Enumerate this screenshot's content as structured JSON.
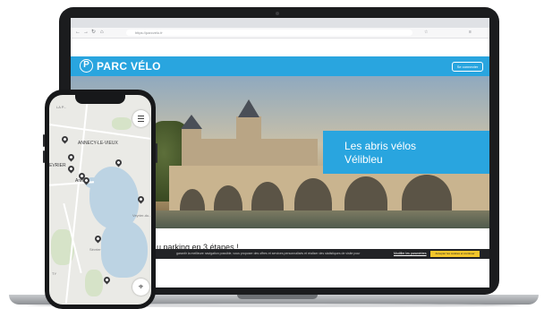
{
  "browser": {
    "url": "https://parcvelo.fr",
    "nav_back": "←",
    "nav_forward": "→",
    "nav_reload": "↻",
    "home": "⌂",
    "star": "☆",
    "menu": "≡"
  },
  "site": {
    "logo_mark": "P",
    "logo_text": "PARC VÉLO",
    "header_button": "Se connecter",
    "accent_color": "#29a5df"
  },
  "hero": {
    "promo_line1": "Les abris vélos",
    "promo_line2": "Vélibleu"
  },
  "page": {
    "section_title": "u parking en 3 étapes !"
  },
  "cookie": {
    "text": "garantir la meilleure navigation possible, vous proposer des offres et services personnalisés et réaliser des statistiques de visite pour",
    "settings_link": "Modifier les paramètres",
    "accept_button": "Accepter les cookies et continuer"
  },
  "map": {
    "labels": {
      "annecy_le_vieux": "ANNECY-LE-VIEUX",
      "la_poya": "LA P...",
      "evrier": "EVRIER",
      "annecy": "Ann...",
      "veyrier": "Veyrier-du...",
      "sevrier": "Sévrier",
      "ty": "TY"
    },
    "icons": {
      "menu": "hamburger-menu-icon",
      "locate": "locate-icon",
      "pin": "map-pin-icon"
    }
  }
}
